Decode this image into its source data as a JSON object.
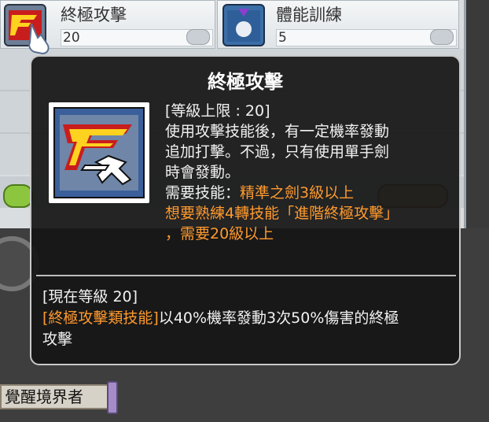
{
  "skill_window": {
    "slots": [
      {
        "name": "終極攻擊",
        "level": "20"
      },
      {
        "name": "體能訓練",
        "level": "5"
      }
    ]
  },
  "character": {
    "name_plate": "覺醒境界者"
  },
  "tooltip": {
    "title": "終極攻擊",
    "max_level": "[等級上限 : 20]",
    "desc_line1": "使用攻擊技能後，有一定機率發動",
    "desc_line2": "追加打擊。不過，只有使用單手劍",
    "desc_line3": "時會發動。",
    "req_label": "需要技能：",
    "req_value": "精準之劍3級以上",
    "req_line2": "想要熟練4轉技能「進階終極攻擊」",
    "req_line3": "，需要20級以上",
    "current_level": "[現在等級 20]",
    "effect_tag": "[終極攻擊類技能]",
    "effect_text": "以40%機率發動3次50%傷害的終極",
    "effect_text2": "攻擊"
  },
  "icons": {
    "skill_icon": "final-attack-icon",
    "skill_icon_2": "physical-training-icon",
    "cursor": "hand-cursor-icon"
  },
  "colors": {
    "highlight": "#ff9a2e",
    "tooltip_bg": "#161616"
  }
}
